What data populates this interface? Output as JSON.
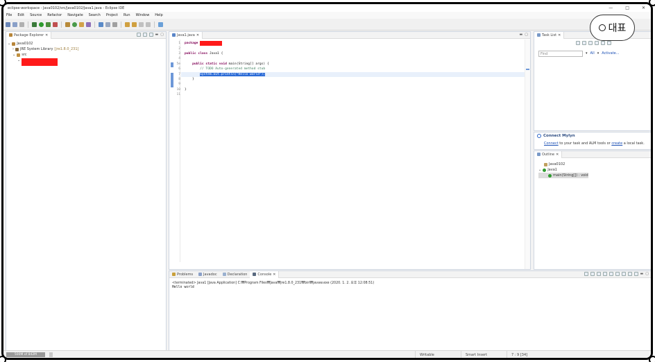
{
  "window": {
    "title": "eclipse-workspace - Java0102/src/Java0102/Java1.java - Eclipse IDE",
    "controls": [
      "—",
      "□",
      "✕"
    ]
  },
  "menu": [
    "File",
    "Edit",
    "Source",
    "Refactor",
    "Navigate",
    "Search",
    "Project",
    "Run",
    "Window",
    "Help"
  ],
  "badge": {
    "label": "대표"
  },
  "package_explorer": {
    "tab": "Package Explorer",
    "tree": {
      "project": "Java0102",
      "jre": "JRE System Library",
      "jre_version": "[jre1.8.0_231]",
      "src": "src"
    }
  },
  "editor": {
    "tab": "Java1.java",
    "lines": [
      {
        "n": "1",
        "parts": [
          {
            "t": "package ",
            "c": "kw"
          },
          {
            "t": "",
            "c": "redact"
          }
        ]
      },
      {
        "n": "2",
        "parts": []
      },
      {
        "n": "3",
        "parts": [
          {
            "t": "public class ",
            "c": "kw"
          },
          {
            "t": "Java1 {",
            "c": ""
          }
        ]
      },
      {
        "n": "4",
        "parts": []
      },
      {
        "n": "5⊖",
        "parts": [
          {
            "t": "    public static void ",
            "c": "kw"
          },
          {
            "t": "main(String[] args) {",
            "c": ""
          }
        ]
      },
      {
        "n": "6",
        "parts": [
          {
            "t": "        // TODO Auto-generated method stub",
            "c": "cmt"
          }
        ]
      },
      {
        "n": "7",
        "parts": [
          {
            "t": "        ",
            "c": ""
          },
          {
            "t": "System.out.println(\"Hello world\");",
            "c": "sel"
          }
        ]
      },
      {
        "n": "8",
        "parts": [
          {
            "t": "    }",
            "c": ""
          }
        ]
      },
      {
        "n": "9",
        "parts": []
      },
      {
        "n": "10",
        "parts": [
          {
            "t": "}",
            "c": ""
          }
        ]
      },
      {
        "n": "11",
        "parts": []
      }
    ]
  },
  "task_list": {
    "tab": "Task List",
    "find_placeholder": "Find",
    "filter_all": "All",
    "activate": "Activate..."
  },
  "mylyn": {
    "title": "Connect Mylyn",
    "connect": "Connect",
    "text_mid": " to your task and ALM tools or ",
    "create": "create",
    "text_end": " a local task."
  },
  "outline": {
    "tab": "Outline",
    "items": [
      "Java0102",
      "Java1",
      "main(String[]) : void"
    ]
  },
  "console": {
    "tabs": [
      "Problems",
      "Javadoc",
      "Declaration",
      "Console"
    ],
    "header": "<terminated> Java1 [Java Application] C:₩Program Files₩Java₩jre1.8.0_231₩bin₩javaw.exe (2020. 1. 2. 오후 12:08:51)",
    "output": "Hello world"
  },
  "status": {
    "heap": "500M of 842M",
    "writable": "Writable",
    "insert_mode": "Smart Insert",
    "position": "7 : 9 [34]"
  },
  "colors": {
    "selection": "#2b6bd7",
    "keyword": "#7f0055",
    "comment": "#3f7f5f",
    "redaction": "#ff1a1a"
  }
}
